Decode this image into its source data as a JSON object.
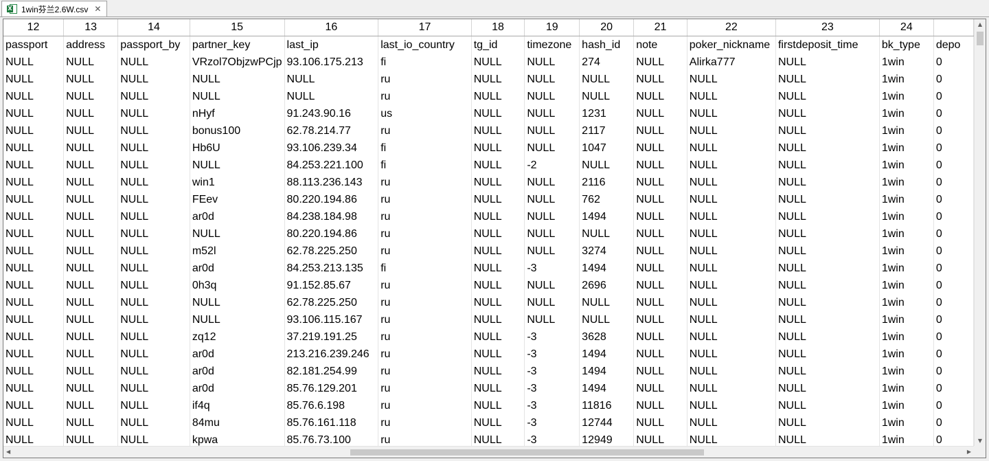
{
  "tab": {
    "title": "1win芬兰2.6W.csv",
    "icon": "excel-csv-icon",
    "close_glyph": "✕"
  },
  "columns": [
    {
      "num": "12",
      "name": "passport"
    },
    {
      "num": "13",
      "name": "address"
    },
    {
      "num": "14",
      "name": "passport_by"
    },
    {
      "num": "15",
      "name": "partner_key"
    },
    {
      "num": "16",
      "name": "last_ip"
    },
    {
      "num": "17",
      "name": "last_io_country"
    },
    {
      "num": "18",
      "name": "tg_id"
    },
    {
      "num": "19",
      "name": "timezone"
    },
    {
      "num": "20",
      "name": "hash_id"
    },
    {
      "num": "21",
      "name": "note"
    },
    {
      "num": "22",
      "name": "poker_nickname"
    },
    {
      "num": "23",
      "name": "firstdeposit_time"
    },
    {
      "num": "24",
      "name": "bk_type"
    },
    {
      "num": "",
      "name": "depo"
    }
  ],
  "rows": [
    [
      "NULL",
      "NULL",
      "NULL",
      "VRzol7ObjzwPCjp",
      "93.106.175.213",
      "fi",
      "NULL",
      "NULL",
      "274",
      "NULL",
      "Alirka777",
      "NULL",
      "1win",
      "0"
    ],
    [
      "NULL",
      "NULL",
      "NULL",
      "NULL",
      "NULL",
      "ru",
      "NULL",
      "NULL",
      "NULL",
      "NULL",
      "NULL",
      "NULL",
      "1win",
      "0"
    ],
    [
      "NULL",
      "NULL",
      "NULL",
      "NULL",
      "NULL",
      "ru",
      "NULL",
      "NULL",
      "NULL",
      "NULL",
      "NULL",
      "NULL",
      "1win",
      "0"
    ],
    [
      "NULL",
      "NULL",
      "NULL",
      "nHyf",
      "91.243.90.16",
      "us",
      "NULL",
      "NULL",
      "1231",
      "NULL",
      "NULL",
      "NULL",
      "1win",
      "0"
    ],
    [
      "NULL",
      "NULL",
      "NULL",
      "bonus100",
      "62.78.214.77",
      "ru",
      "NULL",
      "NULL",
      "2117",
      "NULL",
      "NULL",
      "NULL",
      "1win",
      "0"
    ],
    [
      "NULL",
      "NULL",
      "NULL",
      "Hb6U",
      "93.106.239.34",
      "fi",
      "NULL",
      "NULL",
      "1047",
      "NULL",
      "NULL",
      "NULL",
      "1win",
      "0"
    ],
    [
      "NULL",
      "NULL",
      "NULL",
      "NULL",
      "84.253.221.100",
      "fi",
      "NULL",
      "-2",
      "NULL",
      "NULL",
      "NULL",
      "NULL",
      "1win",
      "0"
    ],
    [
      "NULL",
      "NULL",
      "NULL",
      "win1",
      "88.113.236.143",
      "ru",
      "NULL",
      "NULL",
      "2116",
      "NULL",
      "NULL",
      "NULL",
      "1win",
      "0"
    ],
    [
      "NULL",
      "NULL",
      "NULL",
      "FEev",
      "80.220.194.86",
      "ru",
      "NULL",
      "NULL",
      "762",
      "NULL",
      "NULL",
      "NULL",
      "1win",
      "0"
    ],
    [
      "NULL",
      "NULL",
      "NULL",
      "ar0d",
      "84.238.184.98",
      "ru",
      "NULL",
      "NULL",
      "1494",
      "NULL",
      "NULL",
      "NULL",
      "1win",
      "0"
    ],
    [
      "NULL",
      "NULL",
      "NULL",
      "NULL",
      "80.220.194.86",
      "ru",
      "NULL",
      "NULL",
      "NULL",
      "NULL",
      "NULL",
      "NULL",
      "1win",
      "0"
    ],
    [
      "NULL",
      "NULL",
      "NULL",
      "m52l",
      "62.78.225.250",
      "ru",
      "NULL",
      "NULL",
      "3274",
      "NULL",
      "NULL",
      "NULL",
      "1win",
      "0"
    ],
    [
      "NULL",
      "NULL",
      "NULL",
      "ar0d",
      "84.253.213.135",
      "fi",
      "NULL",
      "-3",
      "1494",
      "NULL",
      "NULL",
      "NULL",
      "1win",
      "0"
    ],
    [
      "NULL",
      "NULL",
      "NULL",
      "0h3q",
      "91.152.85.67",
      "ru",
      "NULL",
      "NULL",
      "2696",
      "NULL",
      "NULL",
      "NULL",
      "1win",
      "0"
    ],
    [
      "NULL",
      "NULL",
      "NULL",
      "NULL",
      "62.78.225.250",
      "ru",
      "NULL",
      "NULL",
      "NULL",
      "NULL",
      "NULL",
      "NULL",
      "1win",
      "0"
    ],
    [
      "NULL",
      "NULL",
      "NULL",
      "NULL",
      "93.106.115.167",
      "ru",
      "NULL",
      "NULL",
      "NULL",
      "NULL",
      "NULL",
      "NULL",
      "1win",
      "0"
    ],
    [
      "NULL",
      "NULL",
      "NULL",
      "zq12",
      "37.219.191.25",
      "ru",
      "NULL",
      "-3",
      "3628",
      "NULL",
      "NULL",
      "NULL",
      "1win",
      "0"
    ],
    [
      "NULL",
      "NULL",
      "NULL",
      "ar0d",
      "213.216.239.246",
      "ru",
      "NULL",
      "-3",
      "1494",
      "NULL",
      "NULL",
      "NULL",
      "1win",
      "0"
    ],
    [
      "NULL",
      "NULL",
      "NULL",
      "ar0d",
      "82.181.254.99",
      "ru",
      "NULL",
      "-3",
      "1494",
      "NULL",
      "NULL",
      "NULL",
      "1win",
      "0"
    ],
    [
      "NULL",
      "NULL",
      "NULL",
      "ar0d",
      "85.76.129.201",
      "ru",
      "NULL",
      "-3",
      "1494",
      "NULL",
      "NULL",
      "NULL",
      "1win",
      "0"
    ],
    [
      "NULL",
      "NULL",
      "NULL",
      "if4q",
      "85.76.6.198",
      "ru",
      "NULL",
      "-3",
      "11816",
      "NULL",
      "NULL",
      "NULL",
      "1win",
      "0"
    ],
    [
      "NULL",
      "NULL",
      "NULL",
      "84mu",
      "85.76.161.118",
      "ru",
      "NULL",
      "-3",
      "12744",
      "NULL",
      "NULL",
      "NULL",
      "1win",
      "0"
    ],
    [
      "NULL",
      "NULL",
      "NULL",
      "kpwa",
      "85.76.73.100",
      "ru",
      "NULL",
      "-3",
      "12949",
      "NULL",
      "NULL",
      "NULL",
      "1win",
      "0"
    ]
  ],
  "scrollbars": {
    "vertical": {
      "up_glyph": "▲",
      "down_glyph": "▼"
    },
    "horizontal": {
      "left_glyph": "◀",
      "right_glyph": "▶"
    }
  }
}
